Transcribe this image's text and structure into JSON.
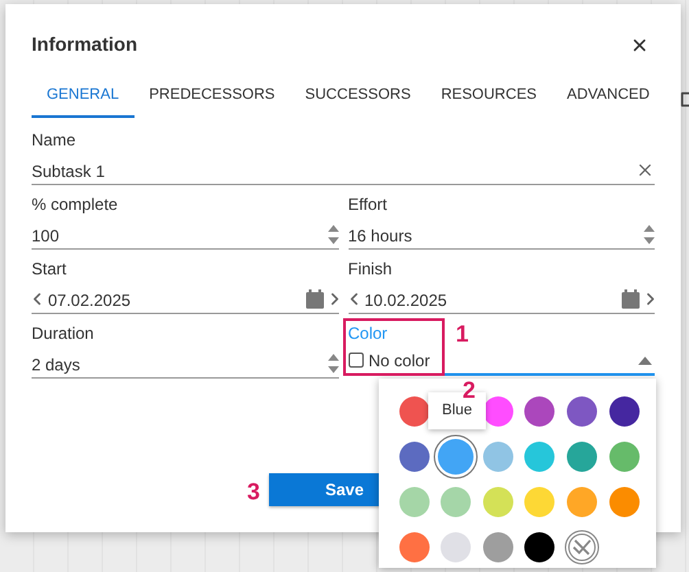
{
  "dialog": {
    "title": "Information"
  },
  "tabs": [
    {
      "label": "GENERAL",
      "selected": true
    },
    {
      "label": "PREDECESSORS",
      "selected": false
    },
    {
      "label": "SUCCESSORS",
      "selected": false
    },
    {
      "label": "RESOURCES",
      "selected": false
    },
    {
      "label": "ADVANCED",
      "selected": false
    }
  ],
  "fields": [
    {
      "kind": "text",
      "label": "Name",
      "value": "Subtask 1"
    },
    {
      "kind": "spin",
      "label": "% complete",
      "value": "100"
    },
    {
      "kind": "spin",
      "label": "Effort",
      "value": "16 hours"
    },
    {
      "kind": "date",
      "label": "Start",
      "value": "07.02.2025"
    },
    {
      "kind": "date",
      "label": "Finish",
      "value": "10.02.2025"
    },
    {
      "kind": "spin",
      "label": "Duration",
      "value": "2 days"
    },
    {
      "kind": "color",
      "label": "Color",
      "value": "No color",
      "checked": false,
      "focused": true
    }
  ],
  "save_button": "Save",
  "palette": {
    "tooltip": "Blue",
    "swatches": [
      {
        "kind": "swatch",
        "color": "#ef5350",
        "selected": false
      },
      {
        "kind": "covered"
      },
      {
        "kind": "swatch",
        "color": "#ff4dff",
        "selected": false
      },
      {
        "kind": "swatch",
        "color": "#ab47bc",
        "selected": false
      },
      {
        "kind": "swatch",
        "color": "#7e57c2",
        "selected": false
      },
      {
        "kind": "swatch",
        "color": "#4527a0",
        "selected": false
      },
      {
        "kind": "swatch",
        "color": "#5c6bc0",
        "selected": false
      },
      {
        "kind": "swatch",
        "color": "#42a5f5",
        "selected": true
      },
      {
        "kind": "swatch",
        "color": "#90c4e4",
        "selected": false
      },
      {
        "kind": "swatch",
        "color": "#26c6da",
        "selected": false
      },
      {
        "kind": "swatch",
        "color": "#26a69a",
        "selected": false
      },
      {
        "kind": "swatch",
        "color": "#66bb6a",
        "selected": false
      },
      {
        "kind": "swatch",
        "color": "#a5d6a7",
        "selected": false
      },
      {
        "kind": "swatch",
        "color": "#a5d6a8",
        "selected": false
      },
      {
        "kind": "swatch",
        "color": "#d4e157",
        "selected": false
      },
      {
        "kind": "swatch",
        "color": "#fdd835",
        "selected": false
      },
      {
        "kind": "swatch",
        "color": "#ffa726",
        "selected": false
      },
      {
        "kind": "swatch",
        "color": "#fb8c00",
        "selected": false
      },
      {
        "kind": "swatch",
        "color": "#ff7043",
        "selected": false
      },
      {
        "kind": "swatch",
        "color": "#e0e0e6",
        "selected": false
      },
      {
        "kind": "swatch",
        "color": "#9e9e9e",
        "selected": false
      },
      {
        "kind": "swatch",
        "color": "#000000",
        "selected": false
      },
      {
        "kind": "none",
        "selected": false
      }
    ]
  },
  "annotations": [
    "1",
    "2",
    "3"
  ]
}
